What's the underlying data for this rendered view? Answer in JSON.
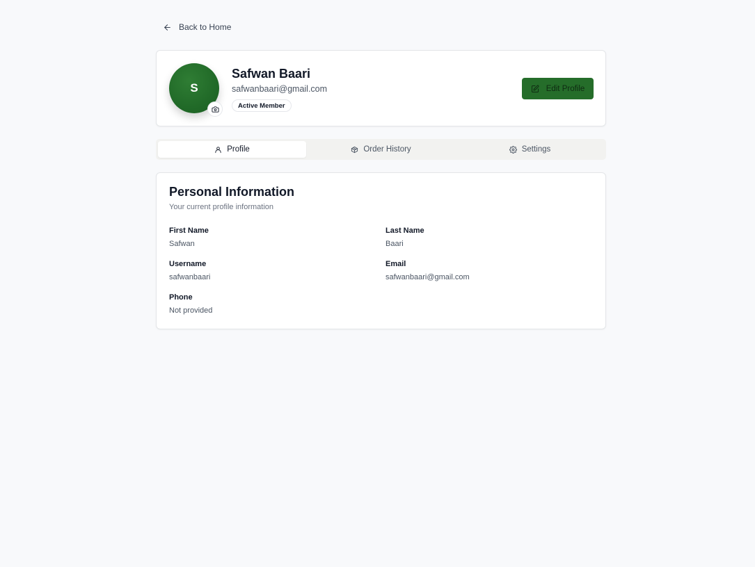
{
  "nav": {
    "back_label": "Back to Home"
  },
  "profile": {
    "avatar_initial": "S",
    "name": "Safwan Baari",
    "email": "safwanbaari@gmail.com",
    "badge": "Active Member",
    "edit_label": "Edit Profile"
  },
  "tabs": [
    {
      "label": "Profile",
      "icon": "user-icon",
      "active": true
    },
    {
      "label": "Order History",
      "icon": "package-icon",
      "active": false
    },
    {
      "label": "Settings",
      "icon": "gear-icon",
      "active": false
    }
  ],
  "personal_info": {
    "title": "Personal Information",
    "subtitle": "Your current profile information",
    "fields": [
      {
        "label": "First Name",
        "value": "Safwan"
      },
      {
        "label": "Last Name",
        "value": "Baari"
      },
      {
        "label": "Username",
        "value": "safwanbaari"
      },
      {
        "label": "Email",
        "value": "safwanbaari@gmail.com"
      },
      {
        "label": "Phone",
        "value": "Not provided"
      }
    ]
  },
  "colors": {
    "brand_green": "#256d2a",
    "page_background": "#f8f9fb"
  }
}
